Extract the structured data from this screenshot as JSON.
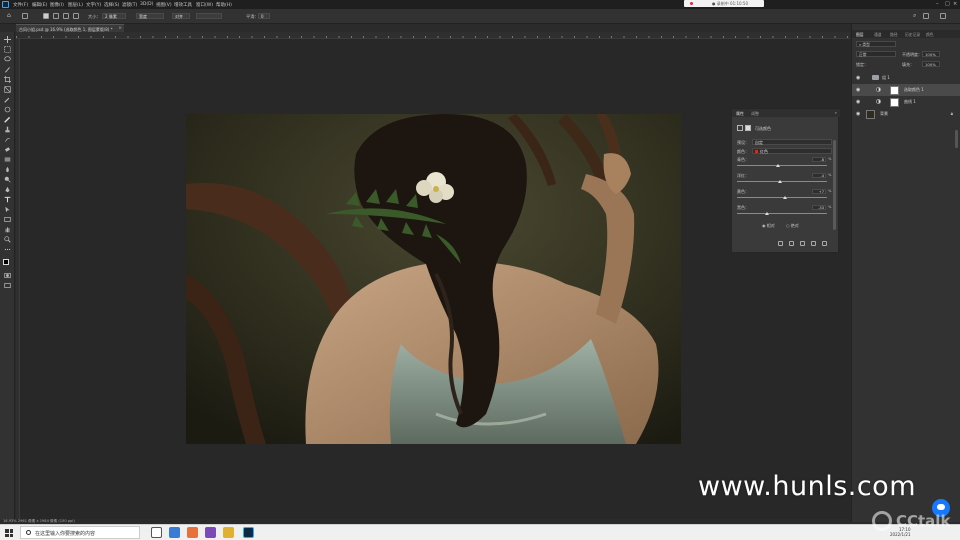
{
  "menubar": {
    "items": [
      "文件(F)",
      "编辑(E)",
      "图像(I)",
      "图层(L)",
      "文字(Y)",
      "选择(S)",
      "滤镜(T)",
      "3D(D)",
      "视图(V)",
      "增效工具",
      "窗口(W)",
      "帮助(H)"
    ],
    "recording_label": "● 录制中 01:10:50"
  },
  "optionsbar": {
    "size_label": "大小：",
    "size_value": "2 像素",
    "field1": "宽度",
    "field2": "对齐",
    "field3": "平滑：",
    "field3_value": "0"
  },
  "document": {
    "tab_title": "古风小姐.psd @ 16.9% (选取颜色 1, 图层蒙版/8) *",
    "tab_close": "×",
    "status": "16.93%    2961 像素 x 1984 像素 (150 ppi)"
  },
  "properties": {
    "tab_active": "属性",
    "tab_inactive": "调整",
    "close": "»",
    "title": "可选颜色",
    "preset_label": "预设：",
    "preset_value": "自定",
    "color_label": "颜色：",
    "color_value": "红色",
    "sliders": [
      {
        "label": "青色：",
        "value": "-8",
        "unit": "%",
        "level": 0.46
      },
      {
        "label": "洋红：",
        "value": "-4",
        "unit": "%",
        "level": 0.48
      },
      {
        "label": "黄色：",
        "value": "+7",
        "unit": "%",
        "level": 0.53
      },
      {
        "label": "黑色：",
        "value": "-33",
        "unit": "%",
        "level": 0.33
      }
    ],
    "radio_relative": "相对",
    "radio_absolute": "绝对"
  },
  "layers_panel": {
    "tabs": [
      "图层",
      "通道",
      "路径",
      "历史记录",
      "颜色"
    ],
    "kind_label": "类型",
    "mode_value": "正常",
    "opacity_label": "不透明度：",
    "opacity_value": "100%",
    "lock_label": "锁定：",
    "fill_label": "填充：",
    "fill_value": "100%",
    "layers": [
      {
        "name": "组 1",
        "type": "group",
        "selected": false
      },
      {
        "name": "选取颜色 1",
        "type": "adjustment",
        "selected": true
      },
      {
        "name": "曲线 1",
        "type": "adjustment",
        "selected": false
      },
      {
        "name": "背景",
        "type": "image",
        "selected": false,
        "locked": true
      }
    ]
  },
  "taskbar": {
    "search_placeholder": "在这里输入你要搜索的内容",
    "time": "17:10",
    "date": "2022/1/21"
  },
  "watermark": {
    "site": "www.hunls.com",
    "brand": "CCtalk"
  },
  "colors": {
    "ps_bg": "#2b2b2b",
    "panel": "#3a3a3a",
    "accent_blue": "#31a8ff",
    "swatch_red": "#d62a1d"
  }
}
